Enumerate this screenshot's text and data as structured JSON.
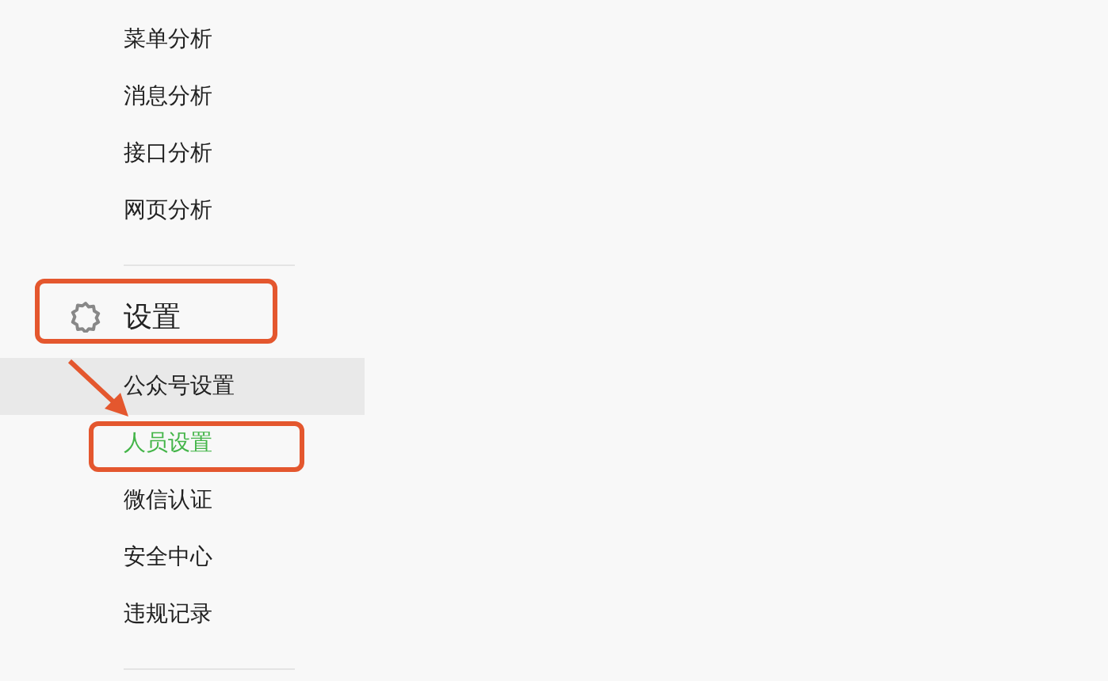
{
  "menu_groups": [
    {
      "items": [
        {
          "label": "菜单分析",
          "selected": false,
          "hovered": false
        },
        {
          "label": "消息分析",
          "selected": false,
          "hovered": false
        },
        {
          "label": "接口分析",
          "selected": false,
          "hovered": false
        },
        {
          "label": "网页分析",
          "selected": false,
          "hovered": false
        }
      ]
    },
    {
      "title": "设置",
      "items": [
        {
          "label": "公众号设置",
          "selected": false,
          "hovered": true
        },
        {
          "label": "人员设置",
          "selected": true,
          "hovered": false
        },
        {
          "label": "微信认证",
          "selected": false,
          "hovered": false
        },
        {
          "label": "安全中心",
          "selected": false,
          "hovered": false
        },
        {
          "label": "违规记录",
          "selected": false,
          "hovered": false
        }
      ]
    }
  ]
}
